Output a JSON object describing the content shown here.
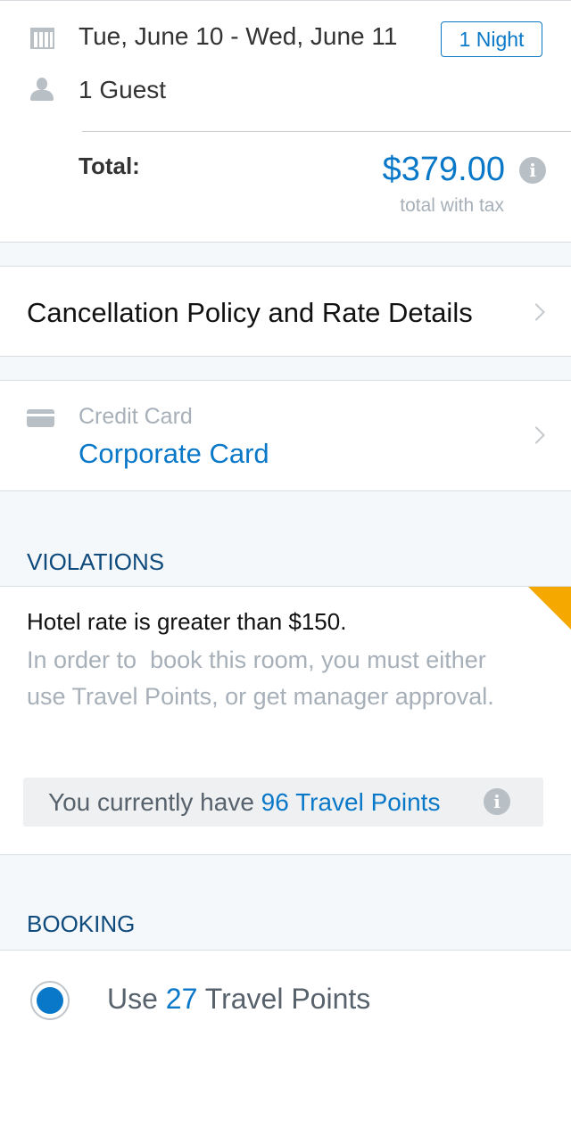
{
  "stay": {
    "dates": "Tue, June 10 - Wed, June 11",
    "nights": "1 Night",
    "guests": "1 Guest",
    "total_label": "Total:",
    "total": "$379.00",
    "total_note": "total with tax"
  },
  "cancellation": {
    "label": "Cancellation Policy and Rate Details"
  },
  "payment": {
    "label": "Credit Card",
    "value": "Corporate Card"
  },
  "violations": {
    "header": "VIOLATIONS",
    "title": "Hotel rate is greater than $150.",
    "body": "In order to  book this room, you must either use Travel Points, or get manager approval.",
    "points_prefix": "You currently have ",
    "points_value": "96 Travel Points"
  },
  "booking": {
    "header": "BOOKING",
    "option_prefix": "Use ",
    "option_points": "27",
    "option_suffix": " Travel Points"
  },
  "colors": {
    "accent": "#0a78c8",
    "warning": "#f5a800"
  }
}
